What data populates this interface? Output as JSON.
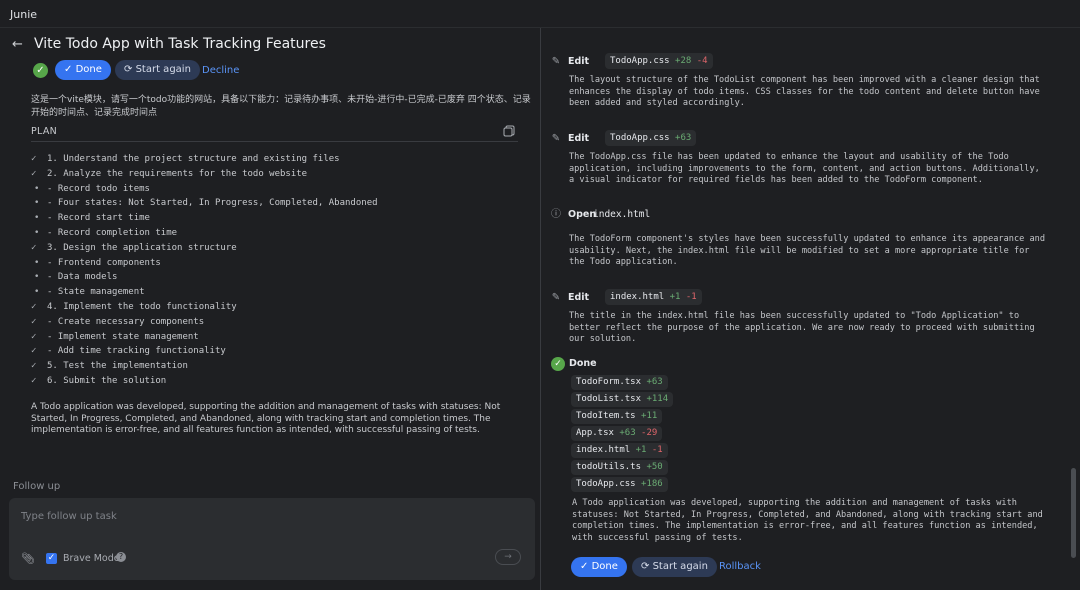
{
  "app": {
    "title": "Junie"
  },
  "task": {
    "back_icon": "←",
    "title": "Vite Todo App with Task Tracking Features",
    "done_label": "Done",
    "start_again_label": "Start again",
    "decline_label": "Decline",
    "description": "这是一个vite模块，请写一个todo功能的网站，具备以下能力：记录待办事项、未开始-进行中-已完成-已废弃 四个状态、记录开始的时间点、记录完成时间点"
  },
  "plan": {
    "heading": "PLAN",
    "items": [
      {
        "mark": "✓",
        "text": "1. Understand the project structure and existing files"
      },
      {
        "mark": "✓",
        "text": "2. Analyze the requirements for the todo website"
      },
      {
        "mark": "•",
        "text": "- Record todo items"
      },
      {
        "mark": "•",
        "text": "- Four states: Not Started, In Progress, Completed, Abandoned"
      },
      {
        "mark": "•",
        "text": "- Record start time"
      },
      {
        "mark": "•",
        "text": "- Record completion time"
      },
      {
        "mark": "✓",
        "text": "3. Design the application structure"
      },
      {
        "mark": "•",
        "text": "- Frontend components"
      },
      {
        "mark": "•",
        "text": "- Data models"
      },
      {
        "mark": "•",
        "text": "- State management"
      },
      {
        "mark": "✓",
        "text": "4. Implement the todo functionality"
      },
      {
        "mark": "✓",
        "text": "- Create necessary components"
      },
      {
        "mark": "✓",
        "text": "- Implement state management"
      },
      {
        "mark": "✓",
        "text": "- Add time tracking functionality"
      },
      {
        "mark": "✓",
        "text": "5. Test the implementation"
      },
      {
        "mark": "✓",
        "text": "6. Submit the solution"
      }
    ],
    "summary": "A Todo application was developed, supporting the addition and management of tasks with statuses: Not Started, In Progress, Completed, and Abandoned, along with tracking start and completion times. The implementation is error-free, and all features function as intended, with successful passing of tests."
  },
  "followup": {
    "label": "Follow up",
    "placeholder": "Type follow up task",
    "brave_mode_label": "Brave Mode",
    "brave_mode_checked": true
  },
  "steps": [
    {
      "icon": "pencil-icon",
      "verb": "Edit",
      "file": "TodoApp.css",
      "added": "+28",
      "removed": "-4",
      "text": "The layout structure of the TodoList component has been improved with a cleaner design that enhances the display of todo items. CSS classes for the todo content and delete button have been added and styled accordingly."
    },
    {
      "icon": "pencil-icon",
      "verb": "Edit",
      "file": "TodoApp.css",
      "added": "+63",
      "removed": "",
      "text": "The TodoApp.css file has been updated to enhance the layout and usability of the Todo application, including improvements to the form, content, and action buttons. Additionally, a visual indicator for required fields has been added to the TodoForm component."
    },
    {
      "icon": "info-icon",
      "verb": "Open",
      "file": "index.html",
      "added": "",
      "removed": "",
      "text": "The TodoForm component's styles have been successfully updated to enhance its appearance and usability. Next, the index.html file will be modified to set a more appropriate title for the Todo application."
    },
    {
      "icon": "pencil-icon",
      "verb": "Edit",
      "file": "index.html",
      "added": "+1",
      "removed": "-1",
      "text": "The title in the index.html file has been successfully updated to \"Todo Application\" to better reflect the purpose of the application. We are now ready to proceed with submitting our solution."
    }
  ],
  "done": {
    "label": "Done",
    "files": [
      {
        "name": "TodoForm.tsx",
        "added": "+63",
        "removed": ""
      },
      {
        "name": "TodoList.tsx",
        "added": "+114",
        "removed": ""
      },
      {
        "name": "TodoItem.ts",
        "added": "+11",
        "removed": ""
      },
      {
        "name": "App.tsx",
        "added": "+63",
        "removed": "-29"
      },
      {
        "name": "index.html",
        "added": "+1",
        "removed": "-1"
      },
      {
        "name": "todoUtils.ts",
        "added": "+50",
        "removed": ""
      },
      {
        "name": "TodoApp.css",
        "added": "+186",
        "removed": ""
      }
    ],
    "summary": "A Todo application was developed, supporting the addition and management of tasks with statuses: Not Started, In Progress, Completed, and Abandoned, along with tracking start and completion times. The implementation is error-free, and all features function as intended, with successful passing of tests.",
    "done_label": "Done",
    "start_again_label": "Start again",
    "rollback_label": "Rollback"
  },
  "colors": {
    "accent": "#3574f0",
    "success": "#57a64a",
    "added": "#6aab73",
    "removed": "#e0666b",
    "link": "#5a94f7"
  }
}
